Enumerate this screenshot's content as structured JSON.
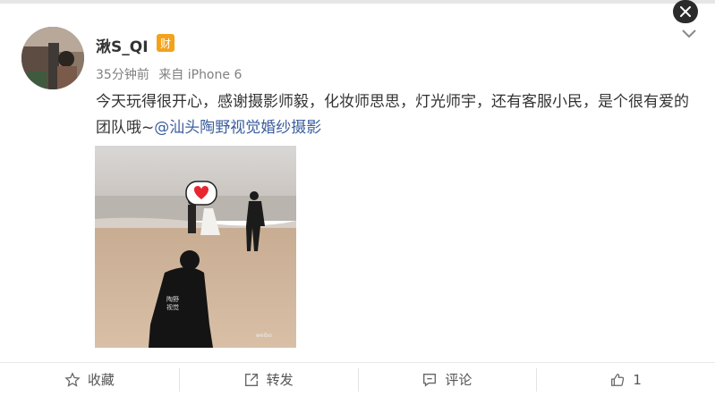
{
  "post": {
    "username": "湫S_QI",
    "badge": "财",
    "time": "35分钟前",
    "source": "来自 iPhone 6",
    "text": "今天玩得很开心，感谢摄影师毅，化妆师思思，灯光师宇，还有客服小民，是个很有爱的团队哦~",
    "mention": "@汕头陶野视觉婚纱摄影",
    "image_alt": "beach photo"
  },
  "actions": {
    "favorite_label": "收藏",
    "repost_label": "转发",
    "comment_label": "评论",
    "like_count": "1"
  },
  "colors": {
    "mention": "#3b5e9e",
    "badge": "#f2a31b",
    "heart": "#e8262f"
  }
}
